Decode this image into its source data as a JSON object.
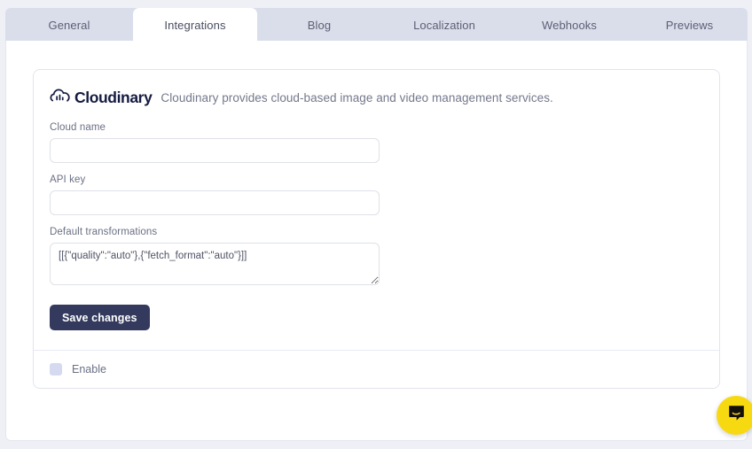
{
  "tabs": [
    {
      "label": "General",
      "active": false
    },
    {
      "label": "Integrations",
      "active": true
    },
    {
      "label": "Blog",
      "active": false
    },
    {
      "label": "Localization",
      "active": false
    },
    {
      "label": "Webhooks",
      "active": false
    },
    {
      "label": "Previews",
      "active": false
    }
  ],
  "integration": {
    "brand_name": "Cloudinary",
    "description": "Cloudinary provides cloud-based image and video management services.",
    "logo_icon": "cloudinary-cloud-icon",
    "fields": {
      "cloud_name": {
        "label": "Cloud name",
        "value": "",
        "placeholder": ""
      },
      "api_key": {
        "label": "API key",
        "value": "",
        "placeholder": ""
      },
      "default_transformations": {
        "label": "Default transformations",
        "value": "[[{\"quality\":\"auto\"},{\"fetch_format\":\"auto\"}]]",
        "placeholder": ""
      }
    },
    "save_label": "Save changes",
    "enable_label": "Enable",
    "enable_checked": false
  },
  "chat": {
    "icon": "chat-bubble-icon",
    "color": "#f7d912"
  },
  "colors": {
    "page_background": "#eef0f6",
    "tabbar_background": "#dadeeb",
    "panel_background": "#ffffff",
    "card_border": "#e3e5ec",
    "button_background": "#333a5e",
    "brand_text": "#151b41",
    "checkbox": "#d5daf0"
  }
}
